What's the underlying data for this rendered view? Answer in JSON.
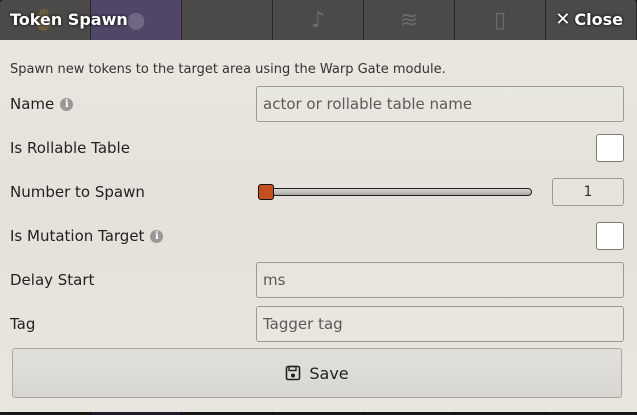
{
  "window": {
    "title": "Token Spawn",
    "close_label": "Close",
    "notes": "Spawn new tokens to the target area using the Warp Gate module."
  },
  "fields": {
    "name": {
      "label": "Name",
      "placeholder": "actor or rollable table name",
      "has_info_icon": true
    },
    "is_rollable_table": {
      "label": "Is Rollable Table",
      "checked": false
    },
    "number_to_spawn": {
      "label": "Number to Spawn",
      "value": "1",
      "min": 1,
      "slider_fraction": 0.0
    },
    "is_mutation_target": {
      "label": "Is Mutation Target",
      "checked": false,
      "has_info_icon": true
    },
    "delay_start": {
      "label": "Delay Start",
      "placeholder": "ms"
    },
    "tag": {
      "label": "Tag",
      "placeholder": "Tagger tag"
    }
  },
  "actions": {
    "save_label": "Save"
  },
  "icons": {
    "info": "info-icon",
    "close": "close-icon",
    "save": "floppy-disk-icon"
  },
  "colors": {
    "slider_thumb": "#c4501c",
    "titlebar_text": "#ffffff"
  }
}
